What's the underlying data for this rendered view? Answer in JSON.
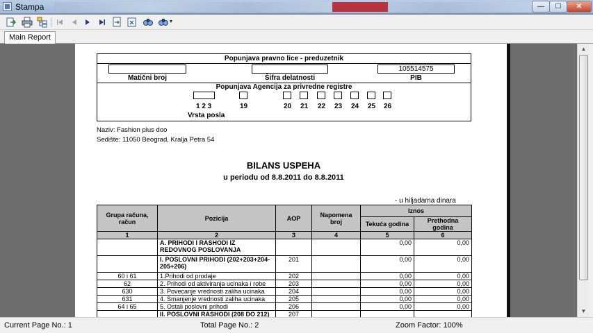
{
  "window": {
    "title": "Stampa",
    "close_glyph": "✕",
    "minimize_glyph": "—",
    "maximize_glyph": "☐"
  },
  "toolbar": {
    "icons": [
      "export-icon",
      "print-icon",
      "group-tree-icon",
      "first-page-icon",
      "previous-page-icon",
      "next-page-icon",
      "last-page-icon",
      "goto-page-icon",
      "close-view-icon",
      "search-icon",
      "zoom-icon"
    ]
  },
  "tab": {
    "label": "Main Report"
  },
  "report": {
    "header": {
      "top_label": "Popunjava pravno lice - preduzetnik",
      "maticni_label": "Matični broj",
      "sifra_label": "Šifra delatnosti",
      "pib_label": "PIB",
      "pib_value": "105514575",
      "agency_label": "Popunjava Agencija za privredne registre",
      "box_labels": [
        "1 2 3",
        "19",
        "20",
        "21",
        "22",
        "23",
        "24",
        "25",
        "26"
      ],
      "vrsta_label": "Vrsta posla"
    },
    "naziv": "Naziv: Fashion plus doo",
    "sediste": "Sedište: 11050 Beograd, Kralja Petra 54",
    "title": "BILANS USPEHA",
    "period": "u periodu od 8.8.2011 do 8.8.2011",
    "unit_note": "- u hiljadama dinara",
    "table": {
      "headers": {
        "grupa": "Grupa računa, račun",
        "pozicija": "Pozicija",
        "aop": "AOP",
        "napomena": "Napomena broj",
        "iznos": "Iznos",
        "tekuca": "Tekuća godina",
        "prethodna": "Prethodna godina"
      },
      "col_numbers": [
        "1",
        "2",
        "3",
        "4",
        "5",
        "6"
      ],
      "rows": [
        {
          "grupa": "",
          "pozicija": "A. PRIHODI I RASHODI IZ REDOVNOG POSLOVANJA",
          "aop": "",
          "napomena": "",
          "tekuca": "0,00",
          "prethodna": "0,00",
          "bold": true
        },
        {
          "grupa": "",
          "pozicija": "I. POSLOVNI PRIHODI (202+203+204-205+206)",
          "aop": "201",
          "napomena": "",
          "tekuca": "0,00",
          "prethodna": "0,00",
          "bold": true
        },
        {
          "grupa": "60 i 61",
          "pozicija": "1.Prihodi od prodaje",
          "aop": "202",
          "napomena": "",
          "tekuca": "0,00",
          "prethodna": "0,00",
          "bold": false
        },
        {
          "grupa": "62",
          "pozicija": "2. Prihodi od aktiviranja ucinaka i robe",
          "aop": "203",
          "napomena": "",
          "tekuca": "0,00",
          "prethodna": "0,00",
          "bold": false
        },
        {
          "grupa": "630",
          "pozicija": "3. Povecanje vrednosti zaliha ucinaka",
          "aop": "204",
          "napomena": "",
          "tekuca": "0,00",
          "prethodna": "0,00",
          "bold": false
        },
        {
          "grupa": "631",
          "pozicija": "4. Smanjenje vrednosti zaliha ucinaka",
          "aop": "205",
          "napomena": "",
          "tekuca": "0,00",
          "prethodna": "0,00",
          "bold": false
        },
        {
          "grupa": "64 i 65",
          "pozicija": "5. Ostali poslovni prihodi",
          "aop": "206",
          "napomena": "",
          "tekuca": "0,00",
          "prethodna": "0,00",
          "bold": false
        },
        {
          "grupa": "",
          "pozicija": "II. POSLOVNI RASHODI (208 DO 212)",
          "aop": "207",
          "napomena": "",
          "tekuca": "",
          "prethodna": "",
          "bold": true
        }
      ]
    }
  },
  "status": {
    "current_page": "Current Page No.: 1",
    "total_page": "Total Page No.: 2",
    "zoom": "Zoom Factor: 100%"
  }
}
